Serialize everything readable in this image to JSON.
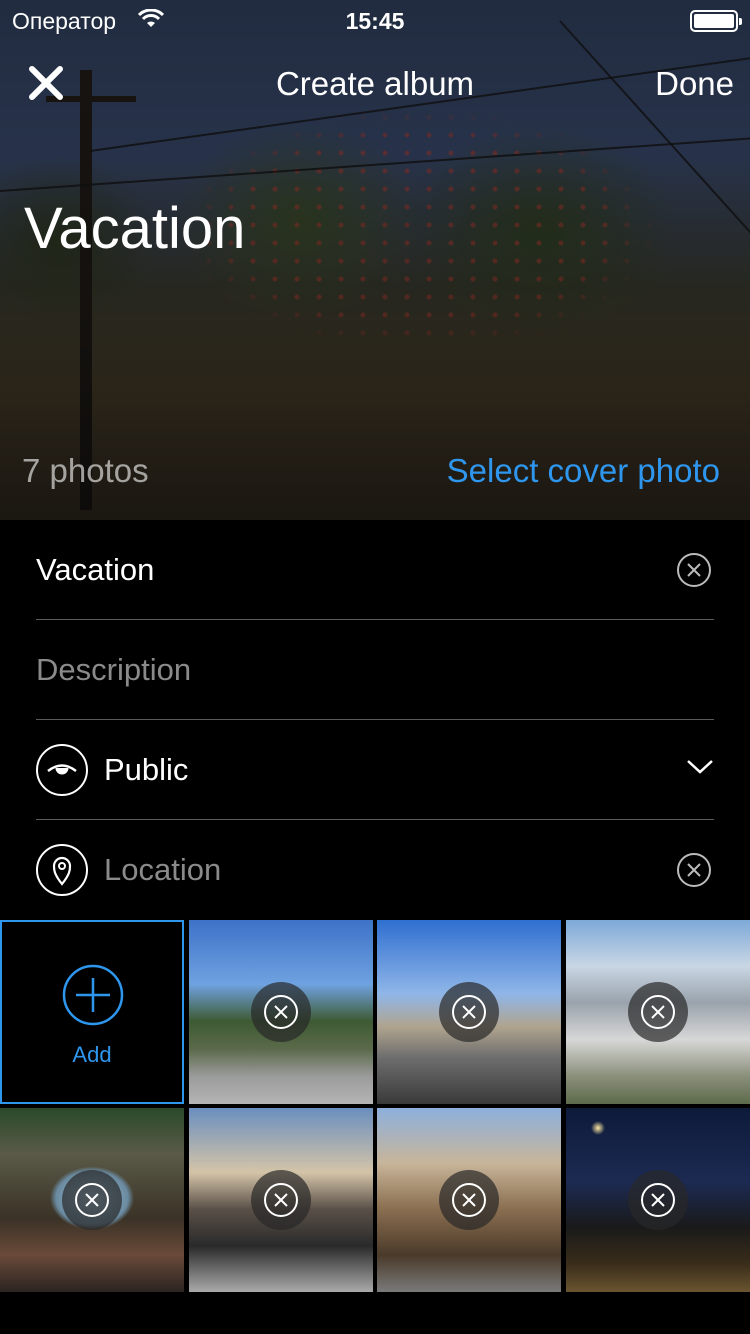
{
  "status_bar": {
    "carrier": "Оператор",
    "time": "15:45"
  },
  "nav": {
    "title": "Create album",
    "done_label": "Done"
  },
  "cover": {
    "album_title": "Vacation",
    "photo_count": "7 photos",
    "select_cover_label": "Select cover photo"
  },
  "form": {
    "name_value": "Vacation",
    "description_placeholder": "Description",
    "visibility_value": "Public",
    "location_placeholder": "Location"
  },
  "grid": {
    "add_label": "Add",
    "photo_count_tiles": 7
  },
  "colors": {
    "accent": "#2f96ee",
    "background": "#000000",
    "separator": "#5a5a5a",
    "placeholder": "#8a8a8a"
  },
  "icons": [
    "close-icon",
    "wifi-icon",
    "battery-icon",
    "clear-icon",
    "eye-icon",
    "chevron-down-icon",
    "location-pin-icon",
    "plus-icon",
    "remove-photo-icon"
  ]
}
